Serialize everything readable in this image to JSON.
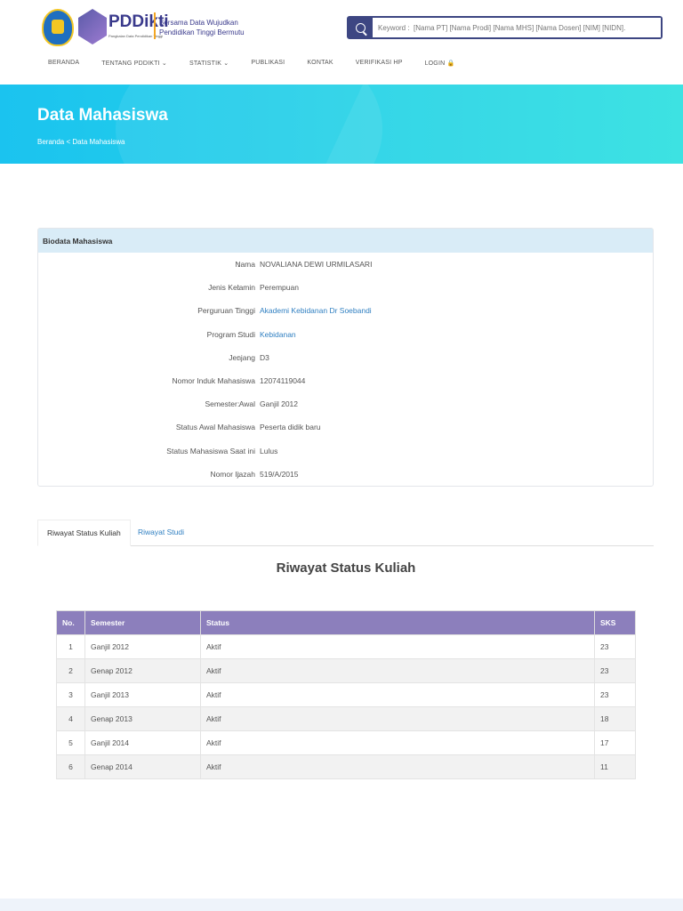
{
  "header": {
    "brand": "PDDikti",
    "brand_sub": "Pangkalan Data Pendidikan Tinggi",
    "tagline_1": "Bersama Data Wujudkan",
    "tagline_2": "Pendidikan Tinggi Bermutu",
    "search_placeholder": "Keyword :  [Nama PT] [Nama Prodi] [Nama MHS] [Nama Dosen] [NIM] [NIDN]."
  },
  "nav": [
    "BERANDA",
    "TENTANG PDDIKTI ⌄",
    "STATISTIK ⌄",
    "PUBLIKASI",
    "KONTAK",
    "VERIFIKASI HP",
    "LOGIN 🔒"
  ],
  "banner": {
    "title": "Data Mahasiswa",
    "breadcrumb": "Beranda < Data Mahasiswa"
  },
  "biodata": {
    "title": "Biodata Mahasiswa",
    "rows": [
      {
        "label": "Nama",
        "value": "NOVALIANA DEWI URMILASARI"
      },
      {
        "label": "Jenis Kelamin",
        "value": "Perempuan"
      },
      {
        "label": "Perguruan Tinggi",
        "value": "Akademi Kebidanan Dr Soebandi"
      },
      {
        "label": "Program Studi",
        "value": "Kebidanan"
      },
      {
        "label": "Jenjang",
        "value": "D3"
      },
      {
        "label": "Nomor Induk Mahasiswa",
        "value": "12074119044"
      },
      {
        "label": "Semester Awal",
        "value": "Ganjil 2012"
      },
      {
        "label": "Status Awal Mahasiswa",
        "value": "Peserta didik baru"
      },
      {
        "label": "Status Mahasiswa Saat ini",
        "value": "Lulus"
      },
      {
        "label": "Nomor Ijazah",
        "value": "519/A/2015"
      }
    ]
  },
  "tabs": {
    "active": "Riwayat Status Kuliah",
    "other": "Riwayat Studi"
  },
  "section_title": "Riwayat Status Kuliah",
  "table": {
    "headers": [
      "No.",
      "Semester",
      "Status",
      "SKS"
    ],
    "rows": [
      [
        "1",
        "Ganjil 2012",
        "Aktif",
        "23"
      ],
      [
        "2",
        "Genap 2012",
        "Aktif",
        "23"
      ],
      [
        "3",
        "Ganjil 2013",
        "Aktif",
        "23"
      ],
      [
        "4",
        "Genap 2013",
        "Aktif",
        "18"
      ],
      [
        "5",
        "Ganjil 2014",
        "Aktif",
        "17"
      ],
      [
        "6",
        "Genap 2014",
        "Aktif",
        "11"
      ]
    ]
  }
}
